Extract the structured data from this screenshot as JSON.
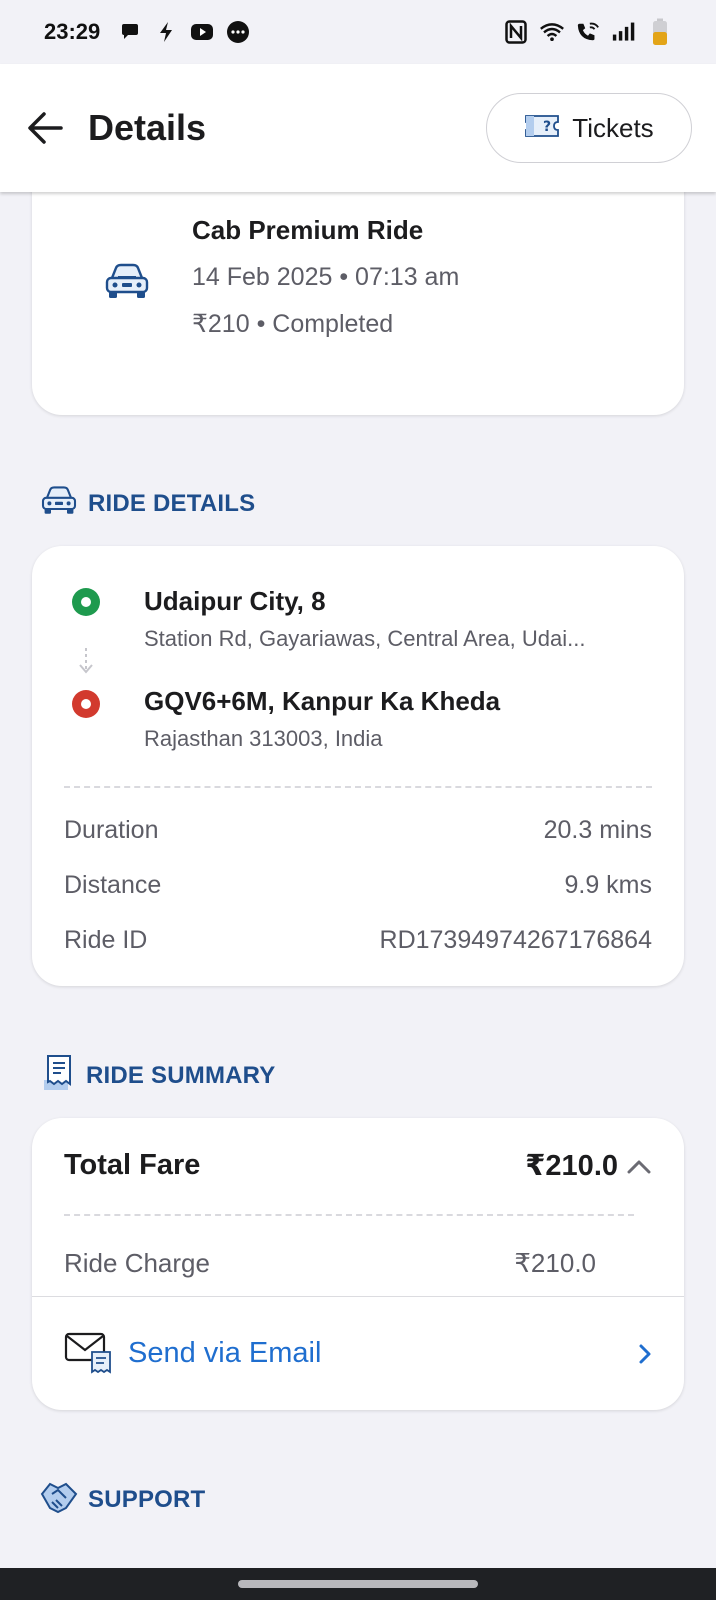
{
  "status_bar": {
    "time": "23:29",
    "left_icons": [
      "chat-bubble-icon",
      "bolt-icon",
      "youtube-icon",
      "messenger-icon"
    ],
    "right_icons": [
      "nfc-icon",
      "wifi-icon",
      "wifi-call-icon",
      "signal-icon",
      "battery-icon"
    ]
  },
  "header": {
    "title": "Details",
    "tickets_label": "Tickets"
  },
  "ride": {
    "type": "Cab Premium Ride",
    "datetime": "14 Feb 2025 • 07:13 am",
    "price_status": "₹210 • Completed"
  },
  "ride_details": {
    "section_title": "RIDE DETAILS",
    "pickup_title": "Udaipur City, 8",
    "pickup_address": "Station Rd, Gayariawas, Central Area, Udai...",
    "drop_title": "GQV6+6M, Kanpur Ka Kheda",
    "drop_address": "Rajasthan 313003, India",
    "rows": [
      {
        "label": "Duration",
        "value": "20.3 mins"
      },
      {
        "label": "Distance",
        "value": "9.9 kms"
      },
      {
        "label": "Ride ID",
        "value": "RD17394974267176864"
      }
    ]
  },
  "ride_summary": {
    "section_title": "RIDE SUMMARY",
    "total_label": "Total Fare",
    "total_value": "₹210.0",
    "charge_label": "Ride Charge",
    "charge_value": "₹210.0",
    "email_label": "Send via Email"
  },
  "support": {
    "section_title": "SUPPORT"
  },
  "colors": {
    "accent_blue": "#1f6ecf",
    "section_title": "#1f4e8c",
    "pickup_green": "#1e9a4e",
    "drop_red": "#d23a2e",
    "background": "#f2f2f7"
  }
}
